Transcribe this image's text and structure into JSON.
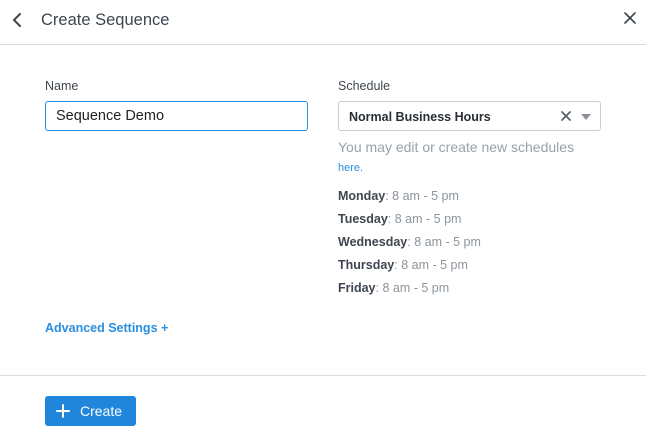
{
  "header": {
    "title": "Create Sequence"
  },
  "form": {
    "name_label": "Name",
    "name_value": "Sequence Demo",
    "schedule_label": "Schedule",
    "schedule_value": "Normal Business Hours",
    "hint_text": "You may edit or create new schedules",
    "hint_link": "here."
  },
  "schedule_days": [
    {
      "day": "Monday",
      "hours": ": 8 am - 5 pm"
    },
    {
      "day": "Tuesday",
      "hours": ": 8 am - 5 pm"
    },
    {
      "day": "Wednesday",
      "hours": ": 8 am - 5 pm"
    },
    {
      "day": "Thursday",
      "hours": ": 8 am - 5 pm"
    },
    {
      "day": "Friday",
      "hours": ": 8 am - 5 pm"
    }
  ],
  "advanced_label": "Advanced Settings +",
  "footer": {
    "create_label": "Create"
  },
  "icons": {
    "back": "chevron-left-icon",
    "close": "close-icon",
    "clear": "clear-icon",
    "dropdown": "caret-down-icon",
    "plus": "plus-icon"
  },
  "colors": {
    "accent": "#1f86dc",
    "link": "#2b8fe0",
    "input_focus_border": "#2b8fe0"
  }
}
